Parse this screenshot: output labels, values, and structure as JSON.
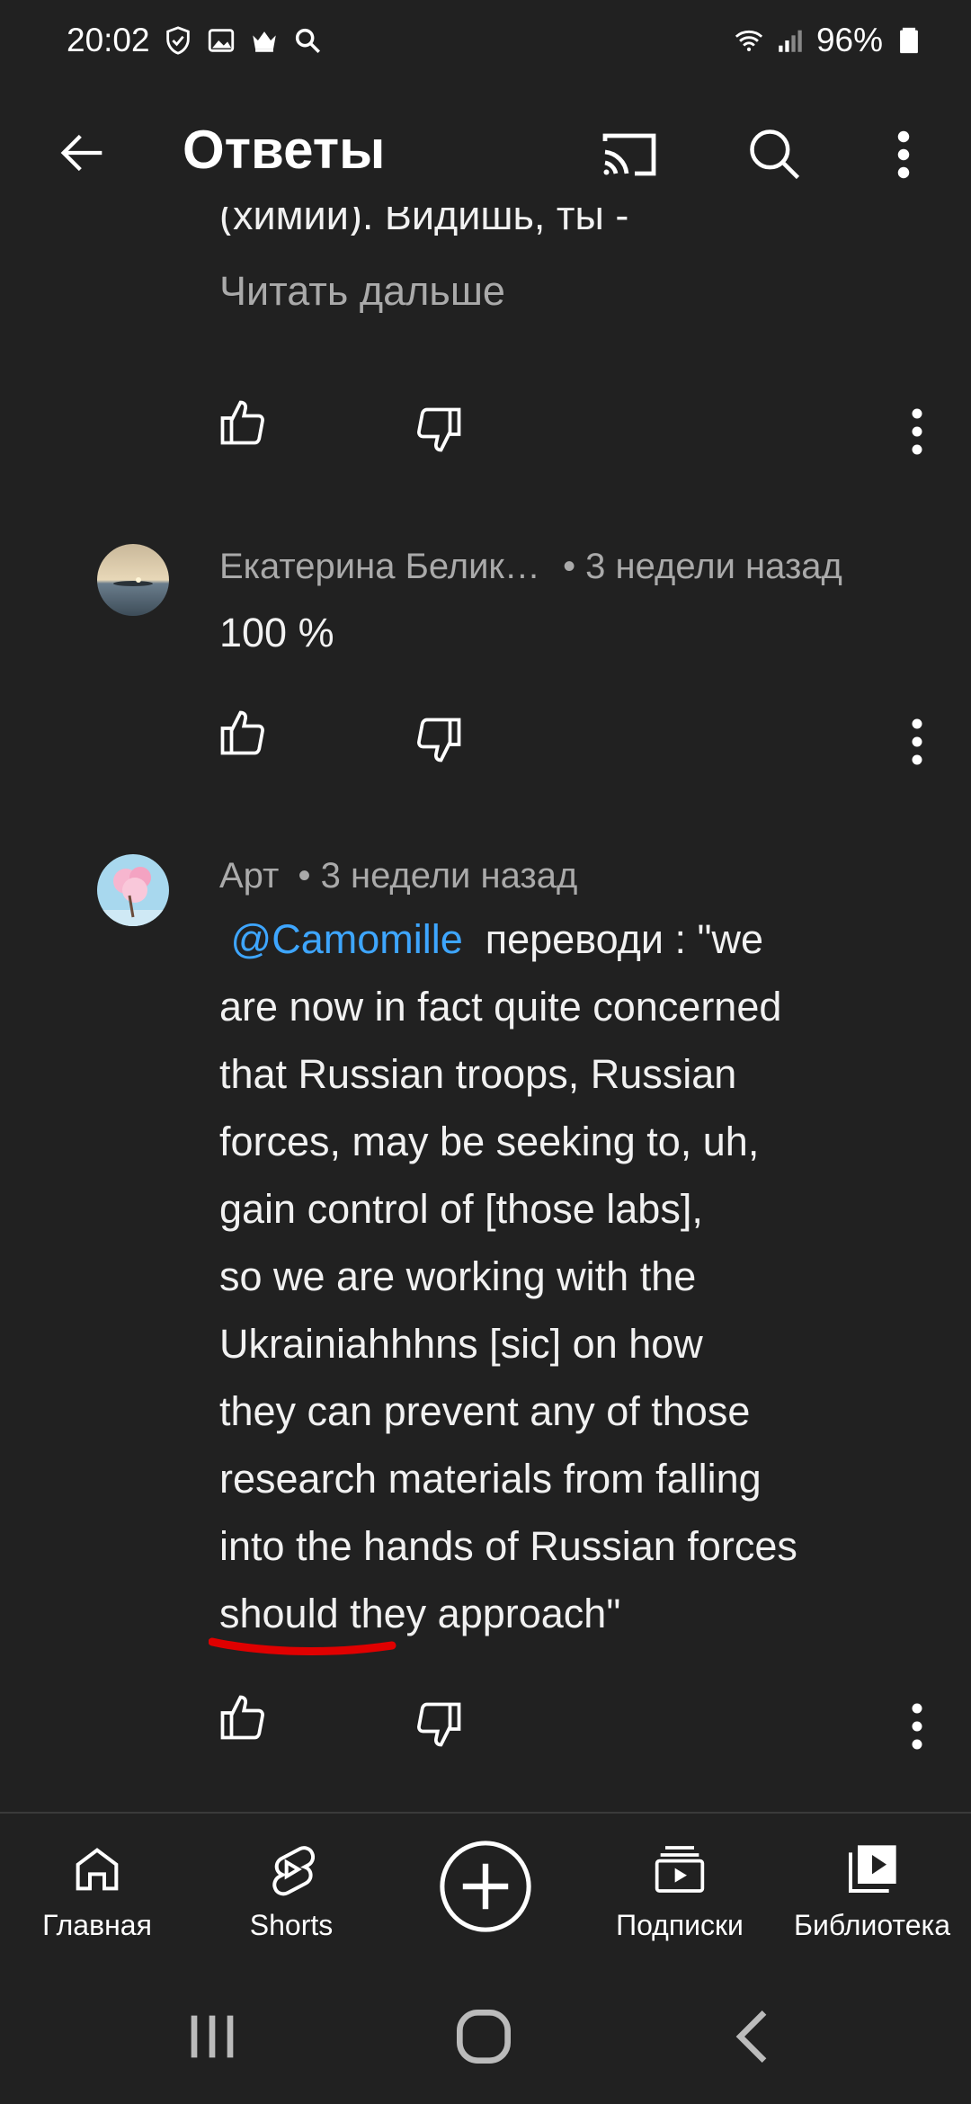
{
  "status_bar": {
    "time": "20:02",
    "battery": "96%",
    "left_icons": [
      "shield-icon",
      "image-icon",
      "crown-icon",
      "search-icon"
    ],
    "right_icons": [
      "wifi-icon",
      "signal-icon",
      "battery-icon"
    ]
  },
  "app_bar": {
    "title": "Ответы",
    "icons": [
      "back-arrow-icon",
      "cast-icon",
      "search-icon",
      "more-vert-icon"
    ]
  },
  "comments": [
    {
      "partial_text": "(химии). Видишь, ты -",
      "read_more": "Читать дальше"
    },
    {
      "author": "Екатерина Белик…",
      "time": "• 3 недели назад",
      "text": "100 %"
    },
    {
      "author": "Арт",
      "time": "• 3 недели назад",
      "mention": "@Camomille",
      "text_after_mention": "переводи :  \"we",
      "lines": [
        "are now in fact quite concerned",
        "that Russian troops, Russian",
        "forces, may be seeking to, uh,",
        "gain control of [those labs],",
        "so we are working with the",
        "Ukrainiahhhns [sic] on how",
        "they can prevent any of those",
        "research materials from falling",
        "into the hands of Russian forces",
        "should they approach\""
      ]
    }
  ],
  "bottom_nav": {
    "items": [
      {
        "label": "Главная",
        "icon": "home-icon"
      },
      {
        "label": "Shorts",
        "icon": "shorts-icon"
      },
      {
        "label": "",
        "icon": "create-plus-icon"
      },
      {
        "label": "Подписки",
        "icon": "subscriptions-icon"
      },
      {
        "label": "Библиотека",
        "icon": "library-icon"
      }
    ]
  },
  "system_nav": [
    "recents-icon",
    "home-circle-icon",
    "back-chevron-icon"
  ],
  "colors": {
    "background": "#212121",
    "text": "#f1f1f1",
    "secondary_text": "#aaaaaa",
    "mention": "#3ea6ff",
    "annotation_red": "#e00000"
  }
}
